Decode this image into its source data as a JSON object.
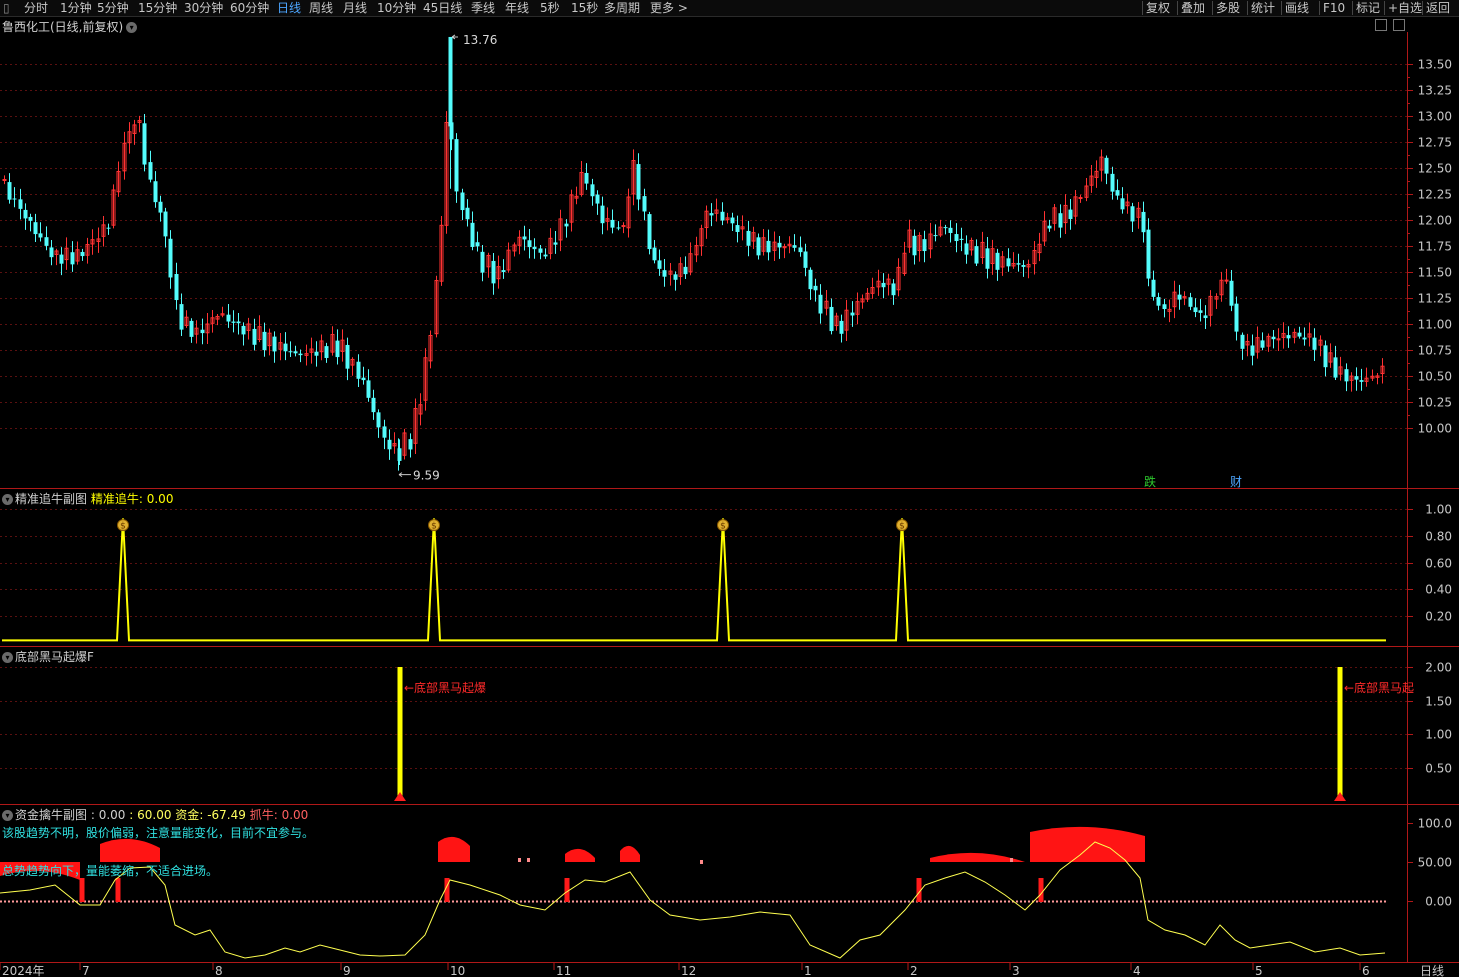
{
  "periods": [
    "分时",
    "1分钟",
    "5分钟",
    "15分钟",
    "30分钟",
    "60分钟",
    "日线",
    "周线",
    "月线",
    "10分钟",
    "45日线",
    "季线",
    "年线",
    "5秒",
    "15秒",
    "多周期",
    "更多 >"
  ],
  "active_period": "日线",
  "toolbar": [
    "复权",
    "叠加",
    "多股",
    "统计",
    "画线",
    "F10",
    "标记",
    "+自选",
    "返回"
  ],
  "stock_title": "鲁西化工(日线,前复权)",
  "main_chart": {
    "y_ticks": [
      "13.50",
      "13.25",
      "13.00",
      "12.75",
      "12.50",
      "12.25",
      "12.00",
      "11.75",
      "11.50",
      "11.25",
      "11.00",
      "10.75",
      "10.50",
      "10.25",
      "10.00"
    ],
    "high_label": "13.76",
    "low_label": "9.59",
    "event_labels": [
      "跌",
      "财"
    ]
  },
  "panel1": {
    "title": "精准追牛副图",
    "indicator_label": "精准追牛",
    "indicator_value": "0.00",
    "y_ticks": [
      "1.00",
      "0.80",
      "0.60",
      "0.40",
      "0.20"
    ]
  },
  "panel2": {
    "title": "底部黑马起爆F",
    "signal_label": "←底部黑马起爆",
    "signal_label_cut": "←底部黑马起",
    "y_ticks": [
      "2.00",
      "1.50",
      "1.00",
      "0.50"
    ]
  },
  "panel3": {
    "title": "资金擒牛副图",
    "v1": ": 0.00",
    "v2": ": 60.00",
    "fund_label": "资金",
    "fund_value": "-67.49",
    "grab_label": "抓牛",
    "grab_value": "0.00",
    "note1": "该股趋势不明，股价偏弱，注意量能变化，目前不宜参与。",
    "note2": "总势趋势向下，量能萎缩，不适合进场。",
    "y_ticks": [
      "100.0",
      "50.00",
      "0.00"
    ]
  },
  "x_axis": {
    "labels": [
      "2024年",
      "7",
      "8",
      "9",
      "10",
      "11",
      "12",
      "1",
      "2",
      "3",
      "4",
      "5",
      "6"
    ],
    "right_label": "日线"
  },
  "chart_data": {
    "type": "candlestick",
    "y_range": [
      9.4,
      13.85
    ],
    "up_color": "#ff3232",
    "down_color": "#54fcfc",
    "high": 13.76,
    "low": 9.59,
    "indicator_peaks": 4,
    "signals": 2
  }
}
